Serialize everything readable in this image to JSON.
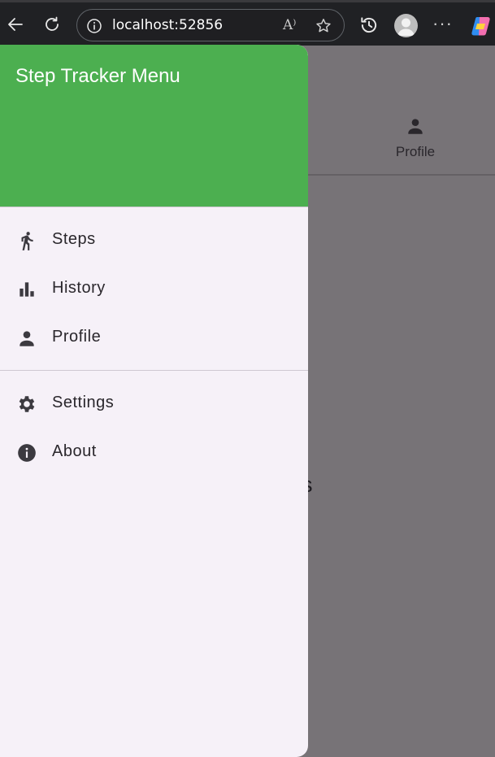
{
  "browser": {
    "url": "localhost:52856",
    "read_aloud_glyph": "A⁾",
    "more_glyph": "···"
  },
  "app": {
    "tab_profile_label": "Profile",
    "partial_text": "os"
  },
  "drawer": {
    "title": "Step Tracker Menu",
    "header_color": "#4caf50",
    "items": [
      {
        "label": "Steps",
        "icon": "walk-icon"
      },
      {
        "label": "History",
        "icon": "bar-chart-icon"
      },
      {
        "label": "Profile",
        "icon": "person-icon"
      }
    ],
    "secondary_items": [
      {
        "label": "Settings",
        "icon": "gear-icon"
      },
      {
        "label": "About",
        "icon": "info-icon"
      }
    ]
  }
}
